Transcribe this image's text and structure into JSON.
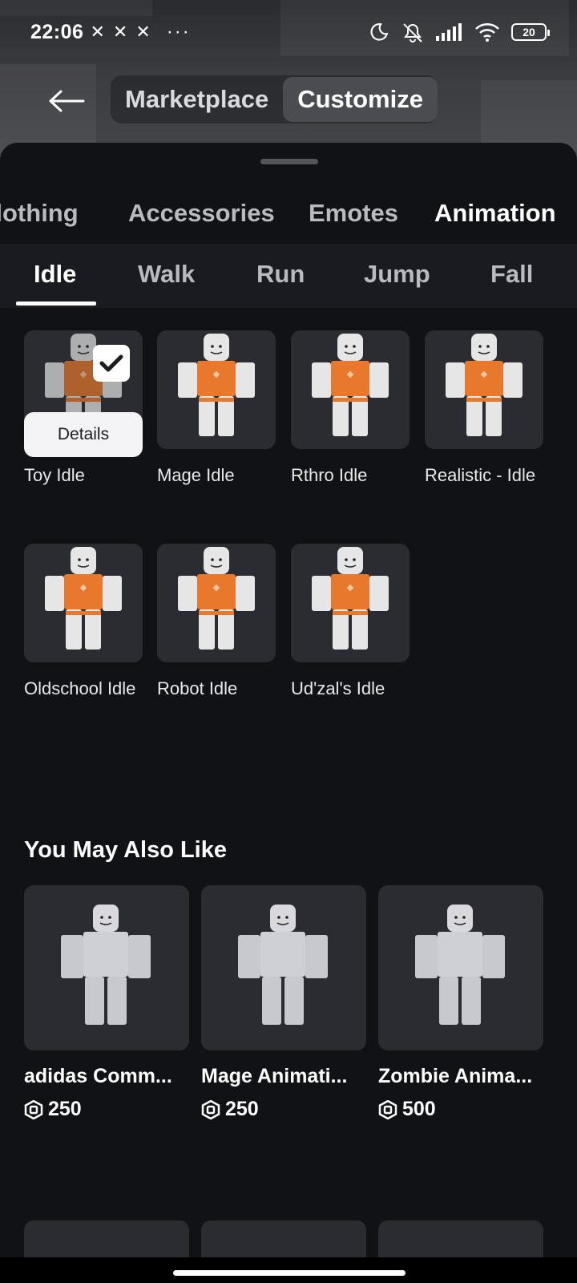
{
  "status_bar": {
    "time": "22:06",
    "notif_glyphs": [
      "✕",
      "✕",
      "✕"
    ],
    "more": "···",
    "battery": "20"
  },
  "header": {
    "tabs": [
      {
        "label": "Marketplace",
        "active": false
      },
      {
        "label": "Customize",
        "active": true
      }
    ]
  },
  "categories": [
    {
      "label": "Clothing",
      "active": false
    },
    {
      "label": "Accessories",
      "active": false
    },
    {
      "label": "Emotes",
      "active": false
    },
    {
      "label": "Animation",
      "active": true
    }
  ],
  "subtabs": [
    {
      "label": "Idle",
      "active": true
    },
    {
      "label": "Walk",
      "active": false
    },
    {
      "label": "Run",
      "active": false
    },
    {
      "label": "Jump",
      "active": false
    },
    {
      "label": "Fall",
      "active": false
    }
  ],
  "items": [
    {
      "label": "Toy Idle",
      "selected": true
    },
    {
      "label": "Mage Idle"
    },
    {
      "label": "Rthro Idle"
    },
    {
      "label": "Realistic - Idle"
    },
    {
      "label": "Oldschool Idle"
    },
    {
      "label": "Robot Idle"
    },
    {
      "label": "Ud'zal's Idle"
    }
  ],
  "details_label": "Details",
  "recommend": {
    "title": "You May Also Like",
    "items": [
      {
        "name": "adidas Comm...",
        "price": "250"
      },
      {
        "name": "Mage Animati...",
        "price": "250"
      },
      {
        "name": "Zombie Anima...",
        "price": "500"
      }
    ]
  },
  "colors": {
    "shirt": "#e8782c",
    "body": "#e6e6e6",
    "tile": "#2a2c32"
  }
}
